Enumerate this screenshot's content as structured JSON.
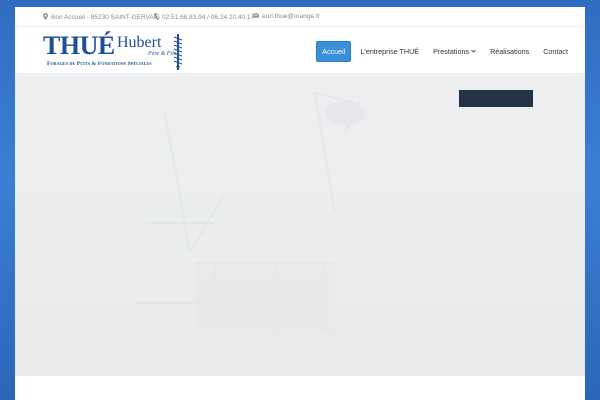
{
  "topbar": {
    "address": "Bon Accueil - 85230 SAINT-GERVAIS",
    "phones": "02.51.68.83.94 / 06.24.20.40.17",
    "email": "eurl.thue@orange.fr"
  },
  "logo": {
    "brand": "THUÉ",
    "name": "Hubert",
    "subtitle": "Père & Fils",
    "tagline": "Forages de Puits & Fondations Spéciales"
  },
  "nav": {
    "items": [
      {
        "label": "Accueil",
        "active": true
      },
      {
        "label": "L'entreprise THUÉ",
        "active": false
      },
      {
        "label": "Prestations",
        "active": false,
        "dropdown": true
      },
      {
        "label": "Réalisations",
        "active": false
      },
      {
        "label": "Contact",
        "active": false
      }
    ]
  },
  "icons": {
    "address": "map-pin-icon",
    "phone": "phone-icon",
    "email": "envelope-icon",
    "dropdown": "chevron-down-icon"
  },
  "colors": {
    "page_background": "#3b7fd4",
    "brand_blue": "#1f4f96",
    "nav_active": "#3a8fd6",
    "hero_box": "#243447"
  }
}
